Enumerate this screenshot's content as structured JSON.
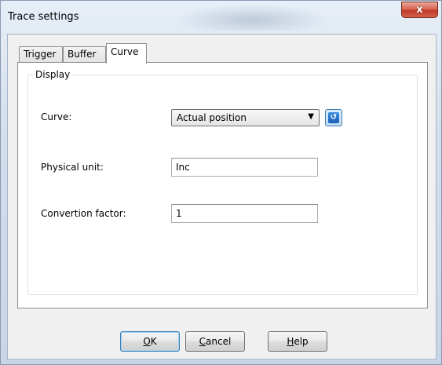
{
  "window": {
    "title": "Trace settings",
    "close_glyph": "x"
  },
  "tabs": [
    {
      "label": "Trigger",
      "selected": false
    },
    {
      "label": "Buffer",
      "selected": false
    },
    {
      "label": "Curve",
      "selected": true
    }
  ],
  "display_group": {
    "legend": "Display",
    "curve": {
      "label": "Curve:",
      "value": "Actual position",
      "arrow_glyph": "▼",
      "refresh_glyph": "↺"
    },
    "physical_unit": {
      "label": "Physical unit:",
      "value": "Inc"
    },
    "conversion_factor": {
      "label": "Convertion factor:",
      "value": "1"
    }
  },
  "buttons": {
    "ok": {
      "mnemonic": "O",
      "rest": "K"
    },
    "cancel": {
      "mnemonic": "C",
      "rest": "ancel"
    },
    "help": {
      "mnemonic": "H",
      "rest": "elp"
    }
  }
}
